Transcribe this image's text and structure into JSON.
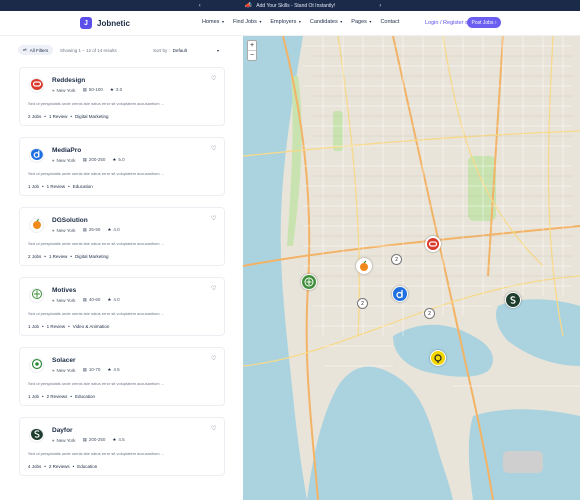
{
  "topbar": {
    "text": "Add Your Skills - Stand Ot Instantly!",
    "prev": "‹",
    "next": "›"
  },
  "header": {
    "logo_text": "Jobnetic",
    "nav": [
      {
        "label": "Homes",
        "caret": "▾"
      },
      {
        "label": "Find Jobs",
        "caret": "▾"
      },
      {
        "label": "Employers",
        "caret": "▾"
      },
      {
        "label": "Candidates",
        "caret": "▾"
      },
      {
        "label": "Pages",
        "caret": "▾"
      },
      {
        "label": "Contact",
        "caret": ""
      }
    ],
    "login": "Login / Register",
    "post_jobs": "Post Jobs"
  },
  "toolbar": {
    "filters": "All Filters",
    "showing": "Showing 1 – 12 of 14 results",
    "sort_label": "Sort by :",
    "sort_value": "Default"
  },
  "companies": [
    {
      "name": "Reddesign",
      "location": "New York",
      "size": "50-100",
      "rating": "3.0",
      "desc": "Sed ut perspiciatis unde omnis iste natus error sit voluptatem accusantium ...",
      "jobs": "2 Jobs",
      "reviews": "1 Review",
      "category": "Digital Marketing",
      "logo_color": "#d93a2b",
      "logo_icon": "reddesign-logo-icon"
    },
    {
      "name": "MediaPro",
      "location": "New York",
      "size": "200-250",
      "rating": "5.0",
      "desc": "Sed ut perspiciatis unde omnis iste natus error sit voluptatem accusantium ...",
      "jobs": "1 Job",
      "reviews": "1 Review",
      "category": "Education",
      "logo_color": "#1f6fe0",
      "logo_icon": "mediapro-logo-icon"
    },
    {
      "name": "DGSolution",
      "location": "New York",
      "size": "25-50",
      "rating": "4.0",
      "desc": "Sed ut perspiciatis unde omnis iste natus error sit voluptatem accusantium ...",
      "jobs": "2 Jobs",
      "reviews": "1 Review",
      "category": "Digital Marketing",
      "logo_color": "#f08a1c",
      "logo_icon": "dgsolution-logo-icon"
    },
    {
      "name": "Motives",
      "location": "New York",
      "size": "40-60",
      "rating": "4.0",
      "desc": "Sed ut perspiciatis unde omnis iste natus error sit voluptatem accusantium ...",
      "jobs": "1 Job",
      "reviews": "1 Review",
      "category": "Video & Animation",
      "logo_color": "#3f8f3a",
      "logo_icon": "motives-logo-icon"
    },
    {
      "name": "Solacer",
      "location": "New York",
      "size": "10-70",
      "rating": "4.5",
      "desc": "Sed ut perspiciatis unde omnis iste natus error sit voluptatem accusantium ...",
      "jobs": "1 Job",
      "reviews": "2 Reviews",
      "category": "Education",
      "logo_color": "#2f8a3c",
      "logo_icon": "solacer-logo-icon"
    },
    {
      "name": "Dayfor",
      "location": "New York",
      "size": "200-250",
      "rating": "4.5",
      "desc": "Sed ut perspiciatis unde omnis iste natus error sit voluptatem accusantium ...",
      "jobs": "4 Jobs",
      "reviews": "2 Reviews",
      "category": "Education",
      "logo_color": "#1f3d2e",
      "logo_icon": "dayfor-logo-icon"
    }
  ],
  "map": {
    "zoom_in": "+",
    "zoom_out": "−",
    "clusters": [
      "2",
      "2",
      "2"
    ]
  }
}
